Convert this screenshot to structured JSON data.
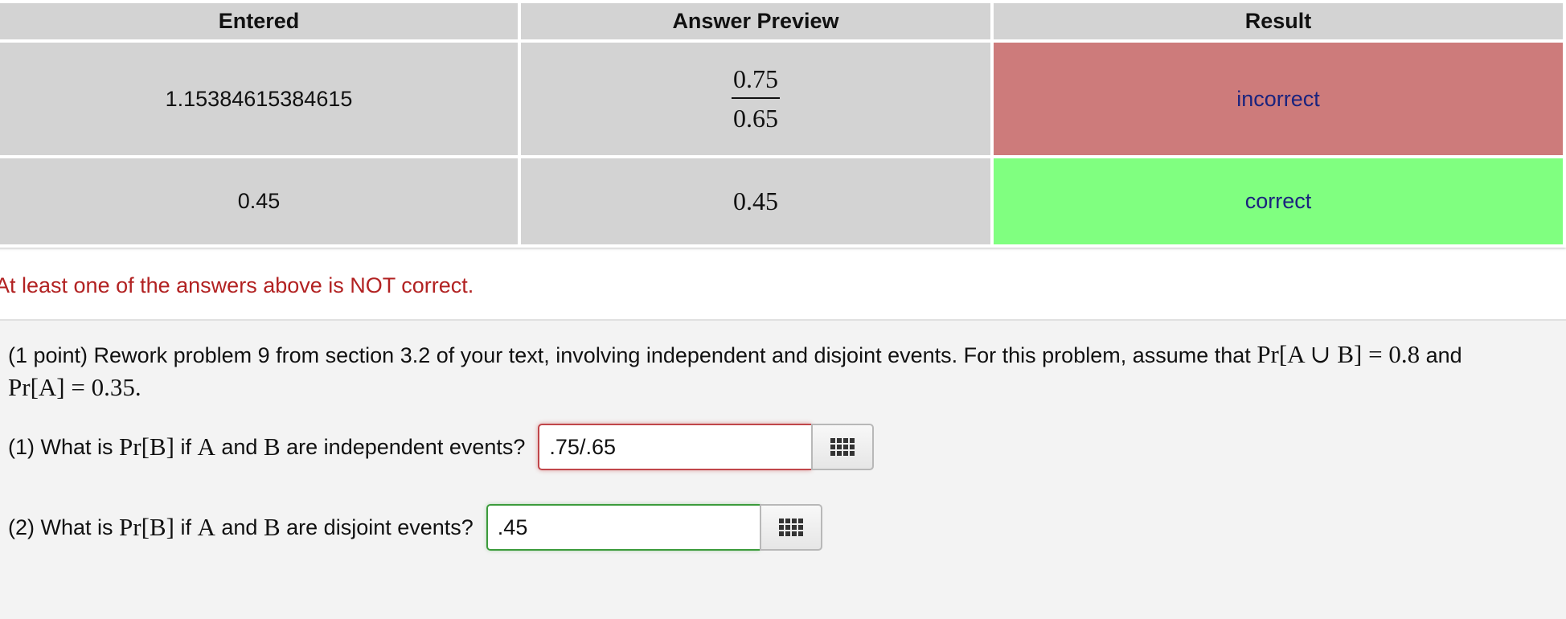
{
  "table": {
    "headers": [
      "Entered",
      "Answer Preview",
      "Result"
    ],
    "rows": [
      {
        "entered": "1.15384615384615",
        "preview_num": "0.75",
        "preview_den": "0.65",
        "result": "incorrect"
      },
      {
        "entered": "0.45",
        "preview": "0.45",
        "result": "correct"
      }
    ],
    "colors": {
      "incorrect": "#cd7b7b",
      "correct": "#80ff80",
      "cell": "#d3d3d3"
    }
  },
  "warning": "At least one of the answers above is NOT correct.",
  "problem": {
    "intro_text": "(1 point) Rework problem 9 from section 3.2 of your text, involving independent and disjoint events. For this problem, assume that",
    "intro_math1": "Pr[A ∪ B] = 0.8",
    "intro_and": "and",
    "intro_math2": "Pr[A] = 0.35",
    "intro_end": ".",
    "q1": {
      "prefix": "(1) What is",
      "pr_b": "Pr[B]",
      "if": "if",
      "a": "A",
      "and": "and",
      "b": "B",
      "suffix": "are independent events?",
      "value": ".75/.65",
      "palette_icon": "grid-icon"
    },
    "q2": {
      "prefix": "(2) What is",
      "pr_b": "Pr[B]",
      "if": "if",
      "a": "A",
      "and": "and",
      "b": "B",
      "suffix": "are disjoint events?",
      "value": ".45",
      "palette_icon": "grid-icon"
    }
  }
}
